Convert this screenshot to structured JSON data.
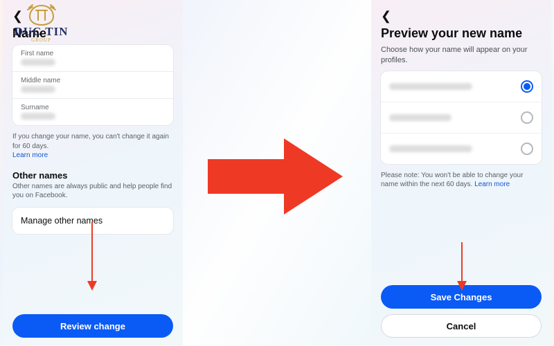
{
  "watermark": {
    "brand": "DUC TIN",
    "sub": "GROUP"
  },
  "left": {
    "title": "Name",
    "fields": {
      "first_label": "First name",
      "middle_label": "Middle name",
      "surname_label": "Surname"
    },
    "note_text": "If you change your name, you can't change it again for 60 days.",
    "learn_more": "Learn more",
    "other_names_heading": "Other names",
    "other_names_sub": "Other names are always public and help people find you on Facebook.",
    "manage_label": "Manage other names",
    "review_btn": "Review change"
  },
  "right": {
    "title": "Preview your new name",
    "subtitle": "Choose how your name will appear on your profiles.",
    "note_prefix": "Please note: You won't be able to change your name within the next 60 days. ",
    "learn_more": "Learn more",
    "save_btn": "Save Changes",
    "cancel_btn": "Cancel"
  }
}
